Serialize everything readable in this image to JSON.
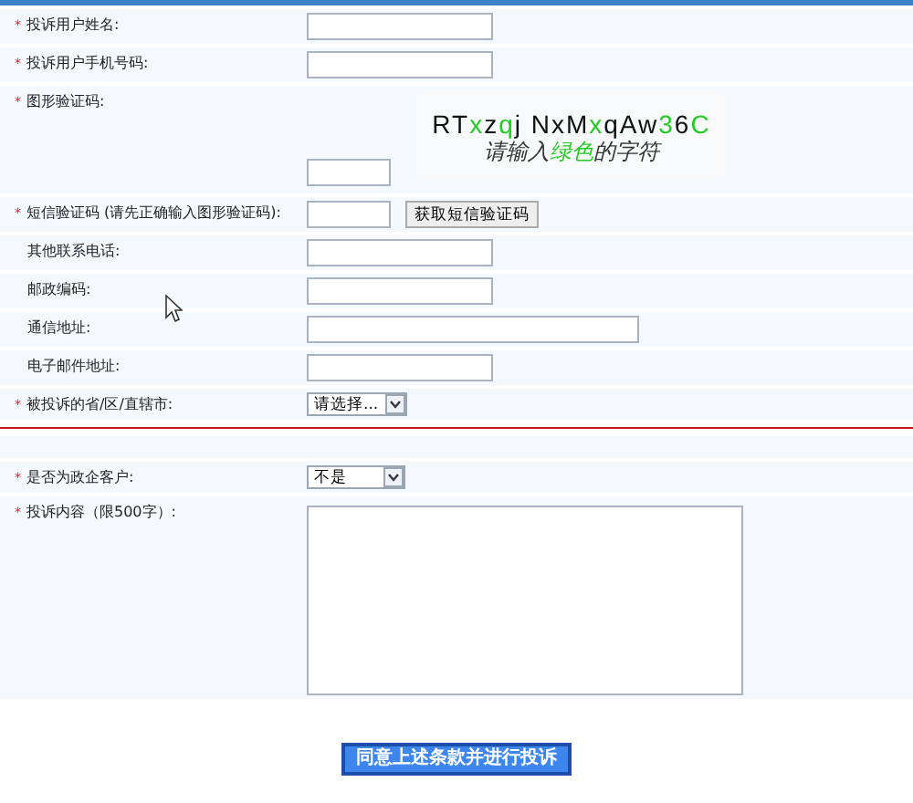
{
  "form_rows": [
    {
      "marker": "*",
      "label": "投诉用户姓名:",
      "kind": "text"
    },
    {
      "marker": "*",
      "label": "投诉用户手机号码:",
      "kind": "text"
    },
    {
      "marker": "*",
      "label": "图形验证码:",
      "kind": "captcha",
      "captcha_chars": [
        {
          "text": "RT",
          "color": "#111111"
        },
        {
          "text": "x",
          "color": "#22cc22"
        },
        {
          "text": "z",
          "color": "#111111"
        },
        {
          "text": "q",
          "color": "#22cc22"
        },
        {
          "text": "j NxM",
          "color": "#111111"
        },
        {
          "text": "x",
          "color": "#22cc22"
        },
        {
          "text": "qAw",
          "color": "#111111"
        },
        {
          "text": "3",
          "color": "#22cc22"
        },
        {
          "text": "6",
          "color": "#111111"
        },
        {
          "text": "C",
          "color": "#22cc22"
        }
      ],
      "captcha_hint": [
        {
          "text": "请输入",
          "color": "#333333"
        },
        {
          "text": "绿色",
          "color": "#22cc22"
        },
        {
          "text": "的字符",
          "color": "#333333"
        }
      ]
    },
    {
      "marker": "*",
      "label": "短信验证码 (请先正确输入图形验证码):",
      "kind": "sms",
      "button": "获取短信验证码"
    },
    {
      "label": "其他联系电话:",
      "kind": "text"
    },
    {
      "label": "邮政编码:",
      "kind": "text"
    },
    {
      "label": "通信地址:",
      "kind": "wide_text"
    },
    {
      "label": "电子邮件地址:",
      "kind": "text"
    },
    {
      "marker": "*",
      "label": "被投诉的省/区/直辖市:",
      "kind": "select",
      "value": "请选择..."
    },
    {
      "kind": "divider"
    },
    {
      "kind": "spacer"
    },
    {
      "marker": "*",
      "label": "是否为政企客户:",
      "kind": "select",
      "value": "不是"
    },
    {
      "marker": "*",
      "label": "投诉内容（限500字）:",
      "kind": "textarea"
    }
  ],
  "submit_button": "同意上述条款并进行投诉"
}
